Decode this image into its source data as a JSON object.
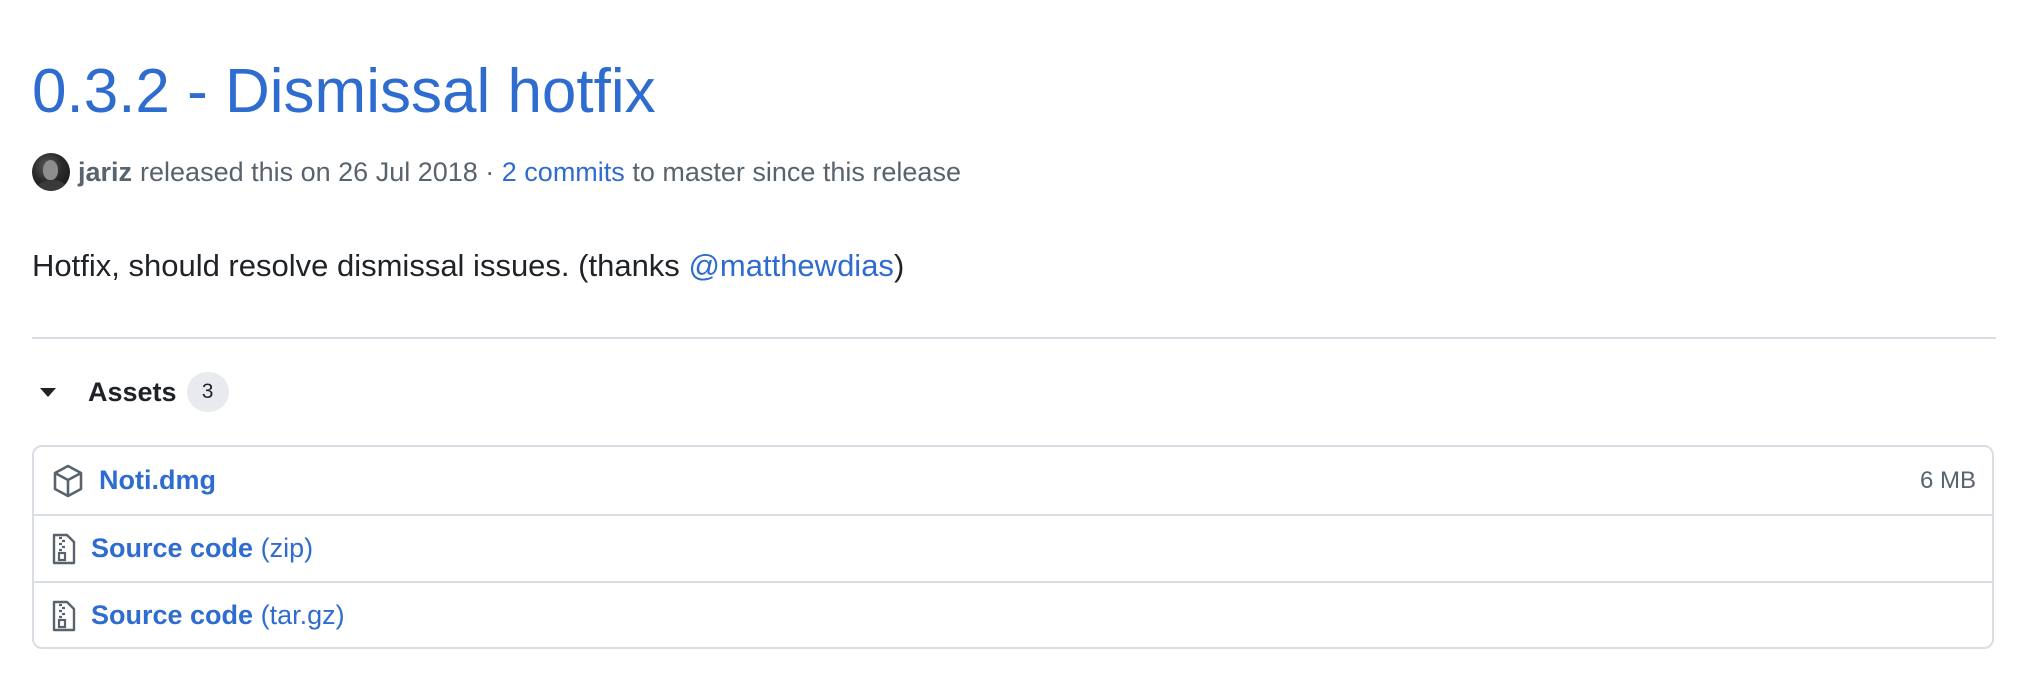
{
  "release": {
    "title": "0.3.2 - Dismissal hotfix",
    "author": "jariz",
    "released_text": "released this on 26 Jul 2018 ·",
    "commits_link": "2 commits",
    "since_text": "to master since this release"
  },
  "body": {
    "text": "Hotfix, should resolve dismissal issues. (thanks",
    "mention": "@matthewdias",
    "closing": ")"
  },
  "assets": {
    "label": "Assets",
    "count": "3",
    "items": [
      {
        "name": "Noti.dmg",
        "suffix": "",
        "size": "6 MB",
        "icon": "package-icon"
      },
      {
        "name": "Source code",
        "suffix": "(zip)",
        "size": "",
        "icon": "file-zip-icon"
      },
      {
        "name": "Source code",
        "suffix": "(tar.gz)",
        "size": "",
        "icon": "file-zip-icon"
      }
    ]
  },
  "colors": {
    "link": "#2f6cd0",
    "text": "#1f2328",
    "muted": "#59636e",
    "border": "#d8dee4"
  }
}
